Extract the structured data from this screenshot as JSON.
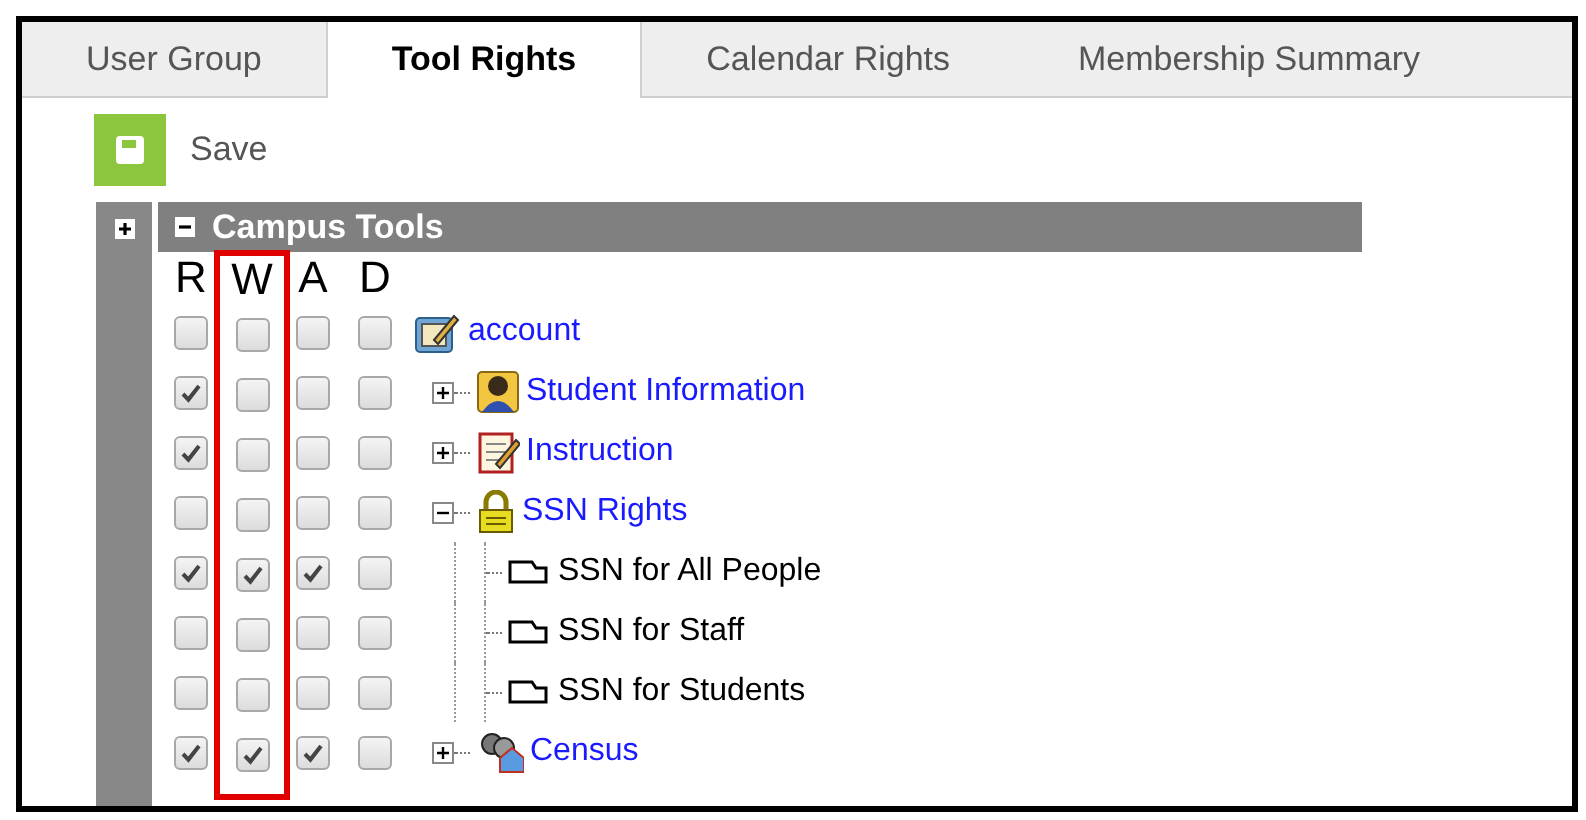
{
  "tabs": [
    {
      "label": "User Group",
      "selected": false
    },
    {
      "label": "Tool Rights",
      "selected": true
    },
    {
      "label": "Calendar Rights",
      "selected": false
    },
    {
      "label": "Membership Summary",
      "selected": false
    }
  ],
  "toolbar": {
    "save_label": "Save"
  },
  "section": {
    "title": "Campus Tools",
    "expanded": true
  },
  "columns": [
    {
      "label": "R",
      "highlighted": false
    },
    {
      "label": "W",
      "highlighted": true
    },
    {
      "label": "A",
      "highlighted": false
    },
    {
      "label": "D",
      "highlighted": false
    }
  ],
  "tree": [
    {
      "label": "account",
      "kind": "account",
      "rights": [
        false,
        false,
        false,
        false
      ]
    },
    {
      "label": "Student Information",
      "kind": "student",
      "expanded": false,
      "rights": [
        true,
        false,
        false,
        false
      ]
    },
    {
      "label": "Instruction",
      "kind": "notebook",
      "expanded": false,
      "rights": [
        true,
        false,
        false,
        false
      ]
    },
    {
      "label": "SSN Rights",
      "kind": "lock",
      "expanded": true,
      "rights": [
        false,
        false,
        false,
        false
      ],
      "children": [
        {
          "label": "SSN for All People",
          "kind": "leaf",
          "rights": [
            true,
            true,
            true,
            false
          ]
        },
        {
          "label": "SSN for Staff",
          "kind": "leaf",
          "rights": [
            false,
            false,
            false,
            false
          ]
        },
        {
          "label": "SSN for Students",
          "kind": "leaf",
          "rights": [
            false,
            false,
            false,
            false
          ]
        }
      ]
    },
    {
      "label": "Census",
      "kind": "census",
      "expanded": false,
      "rights": [
        true,
        true,
        true,
        false
      ]
    }
  ]
}
